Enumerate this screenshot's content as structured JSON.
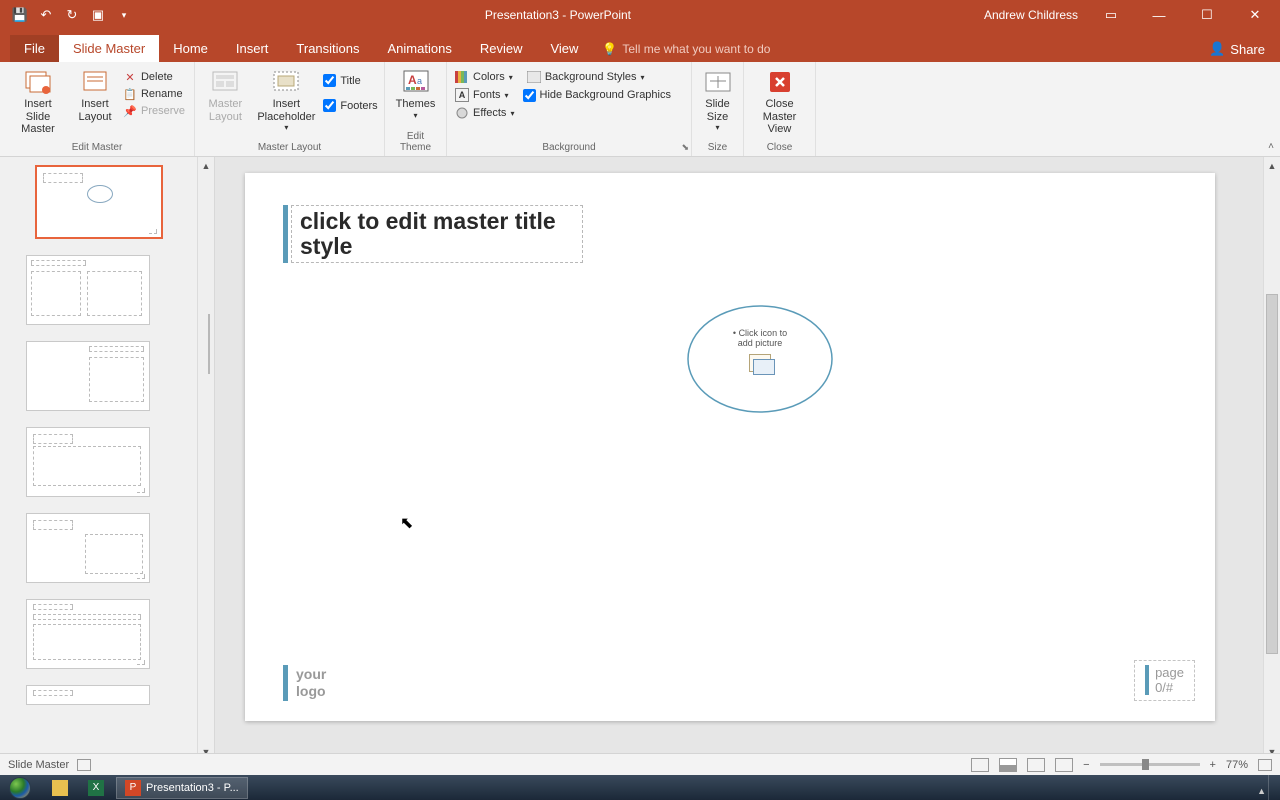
{
  "titlebar": {
    "title": "Presentation3 - PowerPoint",
    "user": "Andrew Childress"
  },
  "tabs": {
    "file": "File",
    "slide_master": "Slide Master",
    "home": "Home",
    "insert": "Insert",
    "transitions": "Transitions",
    "animations": "Animations",
    "review": "Review",
    "view": "View",
    "tellme": "Tell me what you want to do",
    "share": "Share"
  },
  "ribbon": {
    "edit_master": {
      "label": "Edit Master",
      "insert_slide_master": "Insert Slide\nMaster",
      "insert_layout": "Insert\nLayout",
      "delete": "Delete",
      "rename": "Rename",
      "preserve": "Preserve"
    },
    "master_layout": {
      "label": "Master Layout",
      "btn": "Master\nLayout",
      "insert_placeholder": "Insert\nPlaceholder",
      "title": "Title",
      "footers": "Footers"
    },
    "edit_theme": {
      "label": "Edit Theme",
      "themes": "Themes"
    },
    "background": {
      "label": "Background",
      "colors": "Colors",
      "fonts": "Fonts",
      "effects": "Effects",
      "bg_styles": "Background Styles",
      "hide_bg": "Hide Background Graphics"
    },
    "size": {
      "label": "Size",
      "slide_size": "Slide\nSize"
    },
    "close": {
      "label": "Close",
      "close_master": "Close\nMaster View"
    }
  },
  "slide": {
    "title_placeholder": "click to edit master title style",
    "oval_text1": "Click icon to",
    "oval_text2": "add picture",
    "logo_line1": "your",
    "logo_line2": "logo",
    "page_line1": "page",
    "page_line2": "0/#"
  },
  "status": {
    "mode": "Slide Master",
    "zoom": "77%"
  },
  "taskbar": {
    "powerpoint": "Presentation3 - P..."
  }
}
